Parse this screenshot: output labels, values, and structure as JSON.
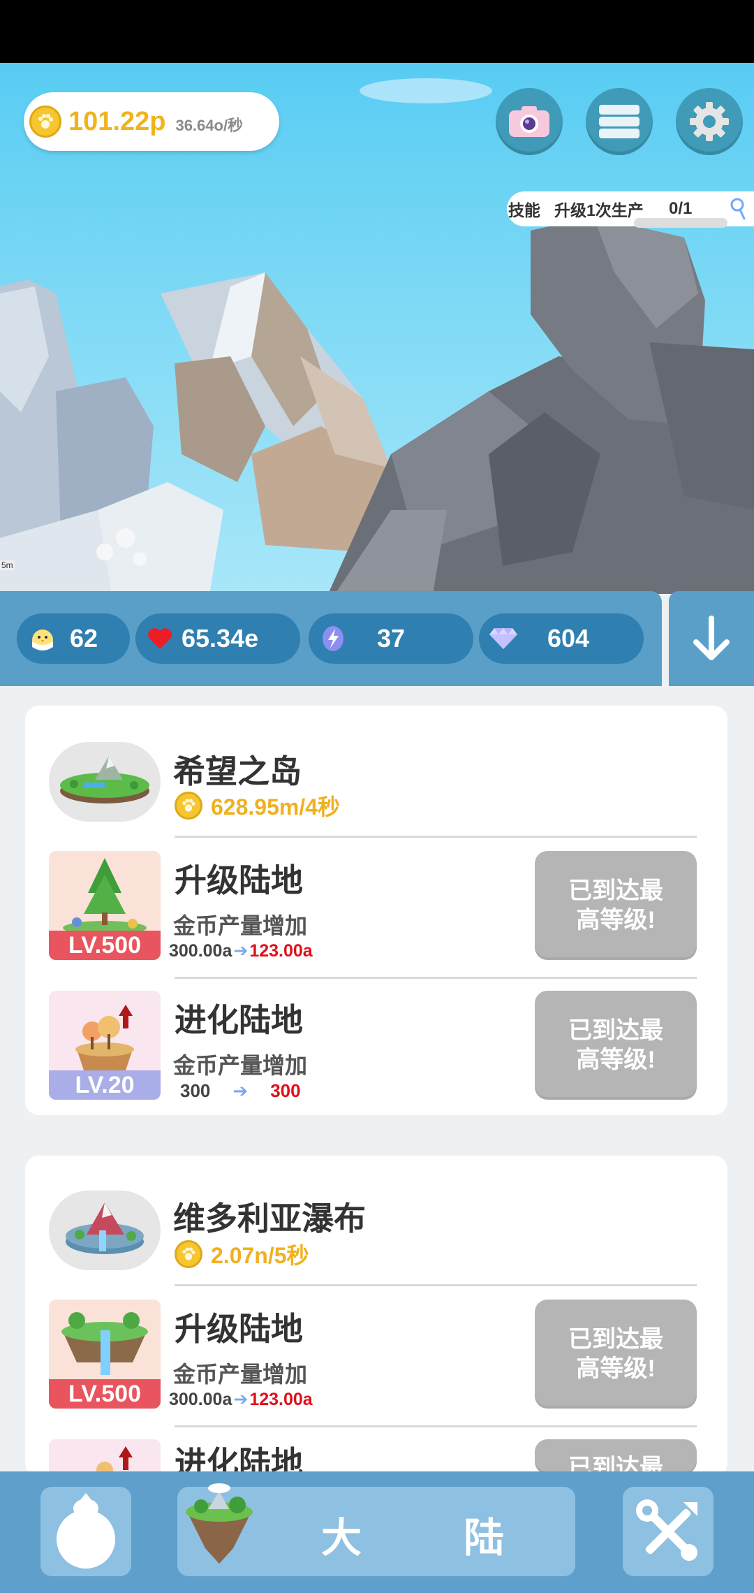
{
  "hud": {
    "coins": "101.22p",
    "coin_rate": "36.64o/秒",
    "quest_category": "技能",
    "quest_text": "升级1次生产",
    "quest_progress": "0/1"
  },
  "stats": {
    "chicks": "62",
    "hearts": "65.34e",
    "energy": "37",
    "diamonds": "604"
  },
  "lands": [
    {
      "name": "希望之岛",
      "rate": "628.95m/4秒",
      "upgrades": [
        {
          "title": "升级陆地",
          "level": "LV.500",
          "desc": "金币产量增加",
          "from": "300.00a",
          "to": "123.00a",
          "button": "已到达最\n高等级!"
        },
        {
          "title": "进化陆地",
          "level": "LV.20",
          "desc": "金币产量增加",
          "from": "300",
          "to": "300",
          "button": "已到达最\n高等级!"
        }
      ]
    },
    {
      "name": "维多利亚瀑布",
      "rate": "2.07n/5秒",
      "upgrades": [
        {
          "title": "升级陆地",
          "level": "LV.500",
          "desc": "金币产量增加",
          "from": "300.00a",
          "to": "123.00a",
          "button": "已到达最\n高等级!"
        },
        {
          "title": "进化陆地",
          "button": "已到达最"
        }
      ]
    }
  ],
  "nav": {
    "continent_label_1": "大",
    "continent_label_2": "陆"
  },
  "scene_label": "5m",
  "colors": {
    "sky": "#58ccf3",
    "panel_blue": "#5a9fc8",
    "pill_blue": "#2f7fb0",
    "gold": "#f1b31d",
    "max_button": "#b5b5b5",
    "level_red": "#e8555e",
    "level_purple": "#a9aee8"
  }
}
